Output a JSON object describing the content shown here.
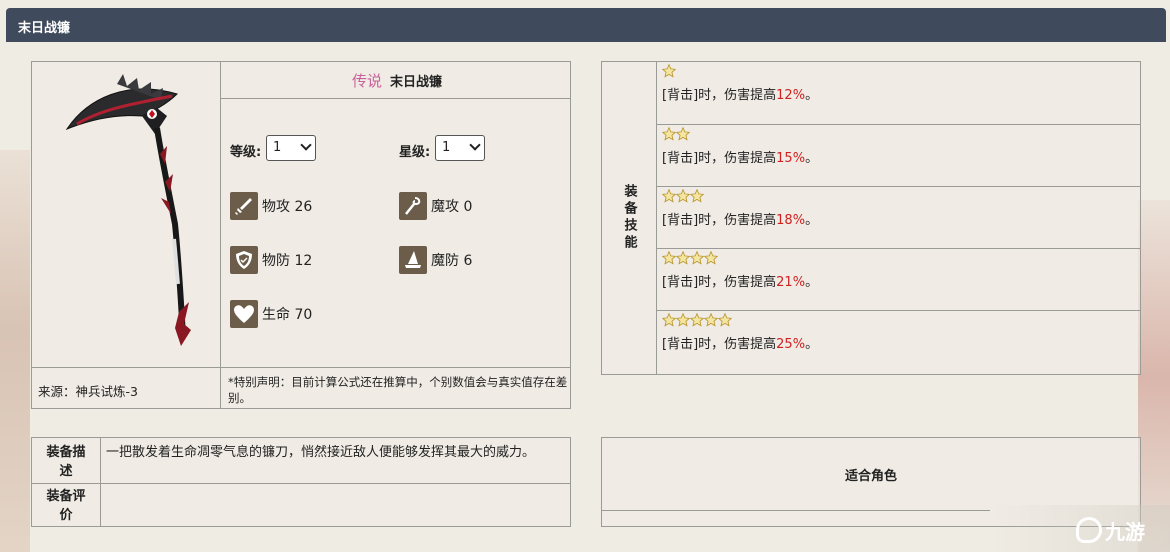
{
  "header": {
    "title": "末日战镰"
  },
  "weapon": {
    "rarity": "传说",
    "name": "末日战镰",
    "level_label": "等级:",
    "level_value": "1",
    "star_label": "星级:",
    "star_value": "1",
    "stats": [
      {
        "label": "物攻 26",
        "icon": "sword-icon"
      },
      {
        "label": "魔攻 0",
        "icon": "staff-icon"
      },
      {
        "label": "物防 12",
        "icon": "shield-icon"
      },
      {
        "label": "魔防 6",
        "icon": "wizard-hat-icon"
      },
      {
        "label": "生命 70",
        "icon": "heart-icon"
      }
    ],
    "source": "来源：神兵试炼-3",
    "note": "*特别声明：目前计算公式还在推算中，个别数值会与真实值存在差别。"
  },
  "skills": {
    "label": "装备技能",
    "rows": [
      {
        "stars": 1,
        "prefix": "[背击]时，伤害提高",
        "pct": "12%",
        "suffix": "。"
      },
      {
        "stars": 2,
        "prefix": "[背击]时，伤害提高",
        "pct": "15%",
        "suffix": "。"
      },
      {
        "stars": 3,
        "prefix": "[背击]时，伤害提高",
        "pct": "18%",
        "suffix": "。"
      },
      {
        "stars": 4,
        "prefix": "[背击]时，伤害提高",
        "pct": "21%",
        "suffix": "。"
      },
      {
        "stars": 5,
        "prefix": "[背击]时，伤害提高",
        "pct": "25%",
        "suffix": "。"
      }
    ]
  },
  "description": {
    "desc_label_1": "装备描",
    "desc_label_2": "述",
    "desc_text": "一把散发着生命凋零气息的镰刀，悄然接近敌人便能够发挥其最大的威力。",
    "eval_label_1": "装备评",
    "eval_label_2": "价",
    "eval_text": ""
  },
  "roles": {
    "title": "适合角色"
  },
  "watermark": {
    "text": "九游"
  },
  "colors": {
    "header_bg": "#3f4a5c",
    "rarity": "#c8609a",
    "percent": "#d02020"
  }
}
